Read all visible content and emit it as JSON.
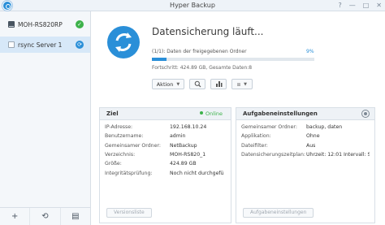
{
  "window": {
    "title": "Hyper Backup",
    "controls": [
      "?",
      "—",
      "□",
      "✕"
    ]
  },
  "sidebar": {
    "tasks": [
      {
        "label": "MOH-RS820RP",
        "status": "ok"
      },
      {
        "label": "rsync Server 1",
        "status": "syncing"
      }
    ],
    "bottom_buttons": [
      "+",
      "⟲",
      "▤"
    ]
  },
  "status": {
    "title": "Datensicherung läuft...",
    "progress_label": "(1/1): Daten der freigegebenen Ordner",
    "progress_percent_text": "9%",
    "progress_value": 0.09,
    "detail": "Fortschritt: 424.89 GB, Gesamte Daten:8"
  },
  "toolbar": {
    "action_label": "Aktion"
  },
  "target_panel": {
    "title": "Ziel",
    "online_label": "Online",
    "rows": [
      {
        "key": "IP-Adresse:",
        "value": "192.168.10.24"
      },
      {
        "key": "Benutzername:",
        "value": "admin"
      },
      {
        "key": "Gemeinsamer Ordner:",
        "value": "NetBackup"
      },
      {
        "key": "Verzeichnis:",
        "value": "MOH-RS820_1"
      },
      {
        "key": "Größe:",
        "value": "424.89 GB"
      },
      {
        "key": "Integritätsprüfung:",
        "value": "Noch nicht durchgefü"
      }
    ],
    "button_label": "Versionsliste"
  },
  "task_panel": {
    "title": "Aufgabeneinstellungen",
    "rows": [
      {
        "key": "Gemeinsamer Ordner:",
        "value": "backup, daten"
      },
      {
        "key": "Applikation:",
        "value": "Ohne"
      },
      {
        "key": "Dateifilter:",
        "value": "Aus"
      },
      {
        "key": "Datensicherungszeitplan:",
        "value": "Uhrzeit: 12:01 Intervall: S"
      }
    ],
    "button_label": "Aufgabeneinstellungen"
  },
  "colors": {
    "accent": "#2a8fd8",
    "ok": "#3db24a"
  }
}
